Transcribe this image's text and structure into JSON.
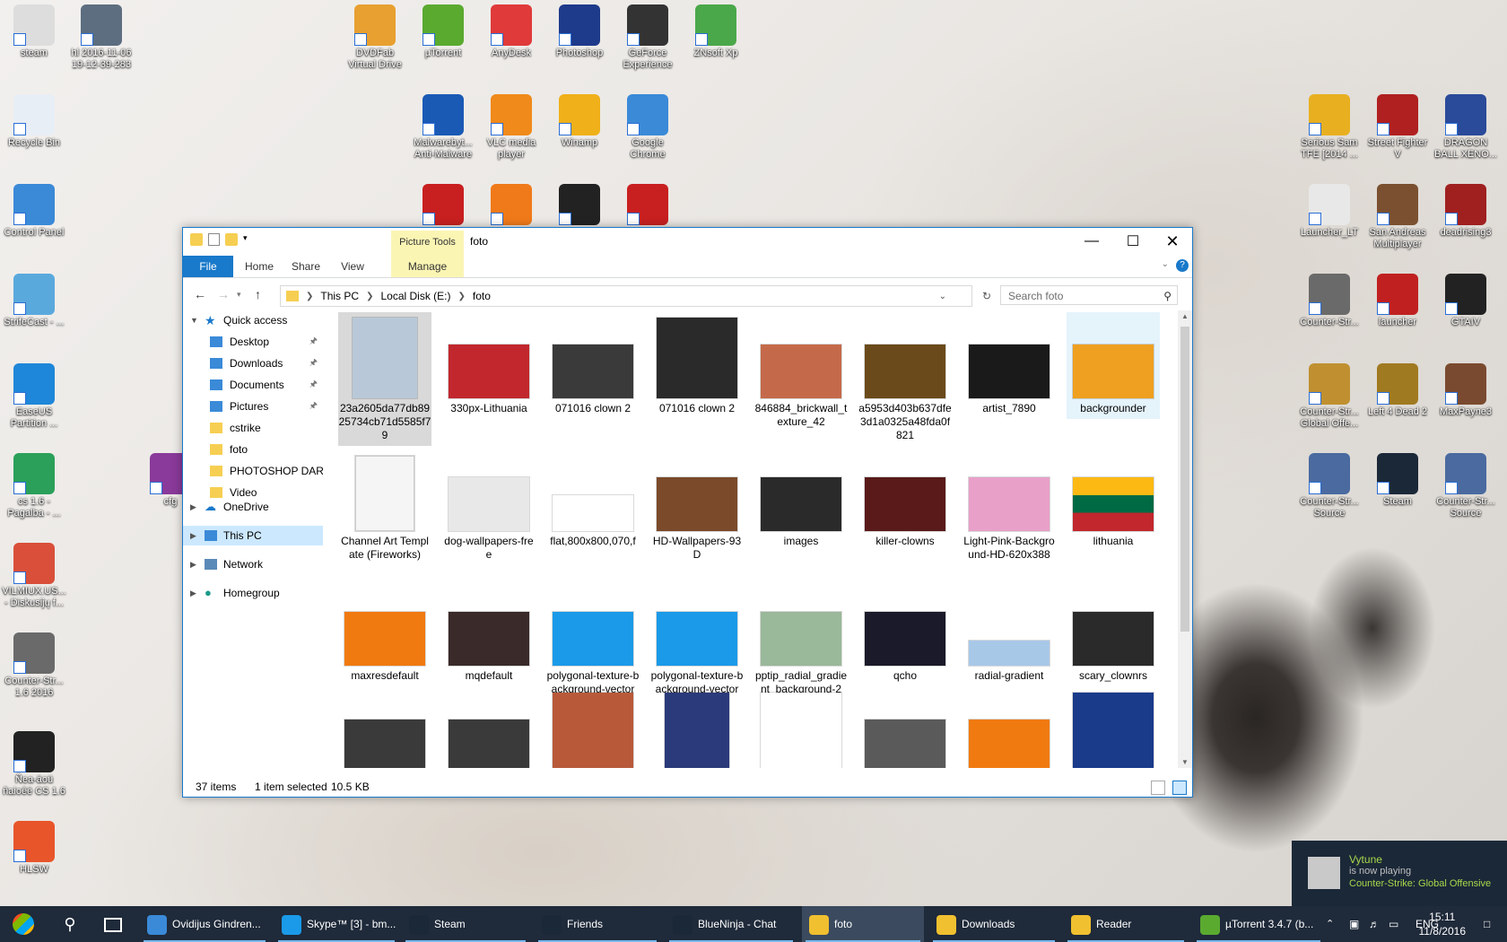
{
  "desktop_icons": [
    {
      "label": "steam",
      "color": "#dddddd"
    },
    {
      "label": "hl 2016-11-06\n19-12-39-283",
      "color": "#5c6e80"
    },
    {
      "label": "Recycle Bin",
      "color": "#e8eef5"
    },
    {
      "label": "Control Panel",
      "color": "#3a8ad8"
    },
    {
      "label": "StrifeCast - ...",
      "color": "#5aa9dd"
    },
    {
      "label": "EaseUS\nPartition ...",
      "color": "#1f87d9"
    },
    {
      "label": "cs 1.6 -\nPagalba - ...",
      "color": "#2aa05a"
    },
    {
      "label": "VILMIUX.US...\n- Diskusijų f...",
      "color": "#d94f3a"
    },
    {
      "label": "Counter-Str...\n1.6 2016",
      "color": "#6a6a6a"
    },
    {
      "label": "Ñea-äoü\nñaioêë CS 1.6",
      "color": "#222222"
    },
    {
      "label": "HLSW",
      "color": "#e8552a"
    },
    {
      "label": "cfg",
      "color": "#8a3a9a"
    },
    {
      "label": "DVDFab\nVirtual Drive",
      "color": "#e8a030"
    },
    {
      "label": "µTorrent",
      "color": "#5aaa30"
    },
    {
      "label": "AnyDesk",
      "color": "#e03a3a"
    },
    {
      "label": "Photoshop",
      "color": "#1e3a8a"
    },
    {
      "label": "GeForce\nExperience",
      "color": "#333333"
    },
    {
      "label": "ZNsoft Xp",
      "color": "#4aa84a"
    },
    {
      "label": "Malwarebyt...\nAnti-Malware",
      "color": "#1a5ab5"
    },
    {
      "label": "VLC media\nplayer",
      "color": "#f08a1a"
    },
    {
      "label": "Winamp",
      "color": "#f0b01a"
    },
    {
      "label": "Google\nChrome",
      "color": "#3a8ad8"
    },
    {
      "label": "",
      "color": "#c82020"
    },
    {
      "label": "",
      "color": "#f07a1a"
    },
    {
      "label": "",
      "color": "#222222"
    },
    {
      "label": "",
      "color": "#c82020"
    },
    {
      "label": "Serious Sam\nTFE [2014 ...",
      "color": "#e8b020"
    },
    {
      "label": "Street Fighter\nV",
      "color": "#b02020"
    },
    {
      "label": "DRAGON\nBALL XENO...",
      "color": "#2a4a9a"
    },
    {
      "label": "Launcher_LT",
      "color": "#e8e8e8"
    },
    {
      "label": "San Andreas\nMultiplayer",
      "color": "#7a5030"
    },
    {
      "label": "deadrising3",
      "color": "#a02020"
    },
    {
      "label": "Counter-Str...",
      "color": "#6a6a6a"
    },
    {
      "label": "launcher",
      "color": "#c02020"
    },
    {
      "label": "GTAIV",
      "color": "#222222"
    },
    {
      "label": "Counter-Str...\nGlobal Offe...",
      "color": "#c09030"
    },
    {
      "label": "Left 4 Dead 2",
      "color": "#a07a20"
    },
    {
      "label": "MaxPayne3",
      "color": "#7a4a30"
    },
    {
      "label": "Counter-Str...\nSource",
      "color": "#4a6aa0"
    },
    {
      "label": "Steam",
      "color": "#1b2838"
    },
    {
      "label": "Counter-Str...\nSource",
      "color": "#4a6aa0"
    }
  ],
  "explorer": {
    "title": "foto",
    "context_tab": "Picture Tools",
    "tabs": {
      "file": "File",
      "home": "Home",
      "share": "Share",
      "view": "View",
      "manage": "Manage"
    },
    "breadcrumb": [
      "This PC",
      "Local Disk (E:)",
      "foto"
    ],
    "search_placeholder": "Search foto",
    "nav": {
      "quick_access": "Quick access",
      "pinned": [
        "Desktop",
        "Downloads",
        "Documents",
        "Pictures"
      ],
      "folders": [
        "cstrike",
        "foto",
        "PHOTOSHOP DARB",
        "Video"
      ],
      "onedrive": "OneDrive",
      "this_pc": "This PC",
      "network": "Network",
      "homegroup": "Homegroup"
    },
    "files": [
      {
        "name": "23a2605da77db8925734cb71d5585f79",
        "thumb": "#b8c8d8",
        "shape": "tall"
      },
      {
        "name": "330px-Lithuania",
        "thumb": "#c1272d",
        "shape": "wide"
      },
      {
        "name": "071016 clown 2",
        "thumb": "#3a3a3a",
        "shape": "wide"
      },
      {
        "name": "071016 clown 2",
        "thumb": "#2a2a2a",
        "shape": "square"
      },
      {
        "name": "846884_brickwall_texture_42",
        "thumb": "#c46a4a",
        "shape": "wide"
      },
      {
        "name": "a5953d403b637dfe3d1a0325a48fda0f821",
        "thumb": "#6a4a1a",
        "shape": "wide"
      },
      {
        "name": "artist_7890",
        "thumb": "#1a1a1a",
        "shape": "wide"
      },
      {
        "name": "backgrounder",
        "thumb": "#f0a020",
        "shape": "wide"
      },
      {
        "name": "Channel Art Template (Fireworks)",
        "thumb": "#f5f5f5",
        "shape": "doc"
      },
      {
        "name": "dog-wallpapers-free",
        "thumb": "#e8e8e8",
        "shape": "wide"
      },
      {
        "name": "flat,800x800,070,f",
        "thumb": "#ffffff",
        "shape": "faded"
      },
      {
        "name": "HD-Wallpapers-93D",
        "thumb": "#7a4a2a",
        "shape": "wide"
      },
      {
        "name": "images",
        "thumb": "#2a2a2a",
        "shape": "wide"
      },
      {
        "name": "killer-clowns",
        "thumb": "#5a1a1a",
        "shape": "wide"
      },
      {
        "name": "Light-Pink-Background-HD-620x388",
        "thumb": "#e8a0c8",
        "shape": "wide"
      },
      {
        "name": "lithuania",
        "thumb": "#006a44",
        "shape": "flag"
      },
      {
        "name": "maxresdefault",
        "thumb": "#f07a10",
        "shape": "wide"
      },
      {
        "name": "mqdefault",
        "thumb": "#3a2a2a",
        "shape": "wide"
      },
      {
        "name": "polygonal-texture-background-vector",
        "thumb": "#1a9ae8",
        "shape": "wide"
      },
      {
        "name": "polygonal-texture-background-vector",
        "thumb": "#1a9ae8",
        "shape": "wide"
      },
      {
        "name": "pptip_radial_gradient_background-2",
        "thumb": "#9ab89a",
        "shape": "wide"
      },
      {
        "name": "qcho",
        "thumb": "#1a1a2a",
        "shape": "wide"
      },
      {
        "name": "radial-gradient",
        "thumb": "#a8c8e8",
        "shape": "thin"
      },
      {
        "name": "scary_clownrs",
        "thumb": "#2a2a2a",
        "shape": "wide"
      },
      {
        "name": "",
        "thumb": "#3a3a3a",
        "shape": "wide"
      },
      {
        "name": "",
        "thumb": "#3a3a3a",
        "shape": "wide"
      },
      {
        "name": "",
        "thumb": "#b85a3a",
        "shape": "square"
      },
      {
        "name": "",
        "thumb": "#2a3a7a",
        "shape": "tall"
      },
      {
        "name": "",
        "thumb": "#ffffff",
        "shape": "square"
      },
      {
        "name": "",
        "thumb": "#5a5a5a",
        "shape": "wide"
      },
      {
        "name": "",
        "thumb": "#f07a10",
        "shape": "wide"
      },
      {
        "name": "",
        "thumb": "#1a3a8a",
        "shape": "square"
      }
    ],
    "status": {
      "items": "37 items",
      "selected": "1 item selected",
      "size": "10.5 KB"
    }
  },
  "taskbar": {
    "items": [
      {
        "label": "Ovidijus Gindren...",
        "color": "#3a8ad8"
      },
      {
        "label": "Skype™ [3] - bm...",
        "color": "#1a9ae8"
      },
      {
        "label": "Steam",
        "color": "#1b2838"
      },
      {
        "label": "Friends",
        "color": "#1b2838"
      },
      {
        "label": "BlueNinja - Chat",
        "color": "#1b2838"
      },
      {
        "label": "foto",
        "color": "#f0c030"
      },
      {
        "label": "Downloads",
        "color": "#f0c030"
      },
      {
        "label": "Reader",
        "color": "#f0c030"
      },
      {
        "label": "µTorrent 3.4.7 (b...",
        "color": "#5aaa30"
      }
    ],
    "lang": "ENG",
    "time": "15:11",
    "date": "11/8/2016"
  },
  "notification": {
    "name": "Vytune",
    "status": "is now playing",
    "game": "Counter-Strike: Global Offensive"
  }
}
